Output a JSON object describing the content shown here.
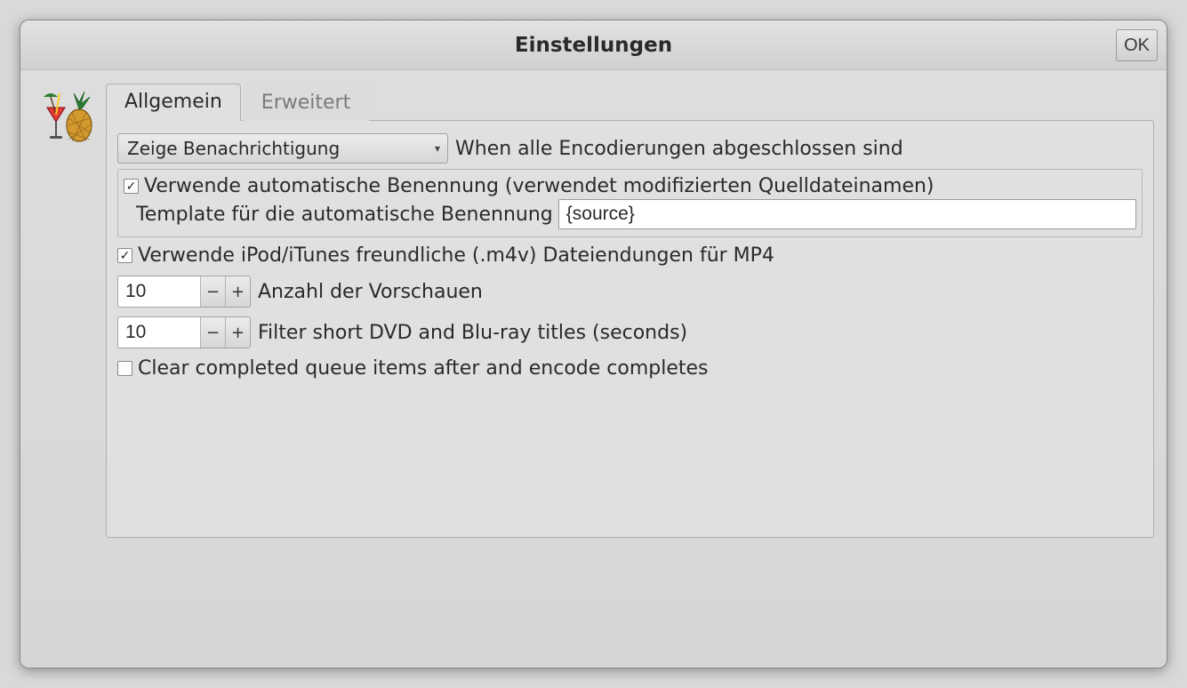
{
  "window": {
    "title": "Einstellungen",
    "ok_label": "OK"
  },
  "tabs": {
    "general": "Allgemein",
    "advanced": "Erweitert"
  },
  "general": {
    "notify_combo_value": "Zeige Benachrichtigung",
    "notify_label": "When alle Encodierungen abgeschlossen sind",
    "auto_name_check_label": "Verwende automatische Benennung (verwendet modifizierten Quelldateinamen)",
    "auto_name_checked": true,
    "template_label": "Template für die automatische Benennung",
    "template_value": "{source}",
    "m4v_check_label": "Verwende iPod/iTunes freundliche (.m4v) Dateiendungen für MP4",
    "m4v_checked": true,
    "preview_count_value": "10",
    "preview_count_label": "Anzahl der Vorschauen",
    "filter_short_value": "10",
    "filter_short_label": "Filter short DVD and Blu-ray titles (seconds)",
    "clear_queue_label": "Clear completed queue items after and encode completes",
    "clear_queue_checked": false
  }
}
